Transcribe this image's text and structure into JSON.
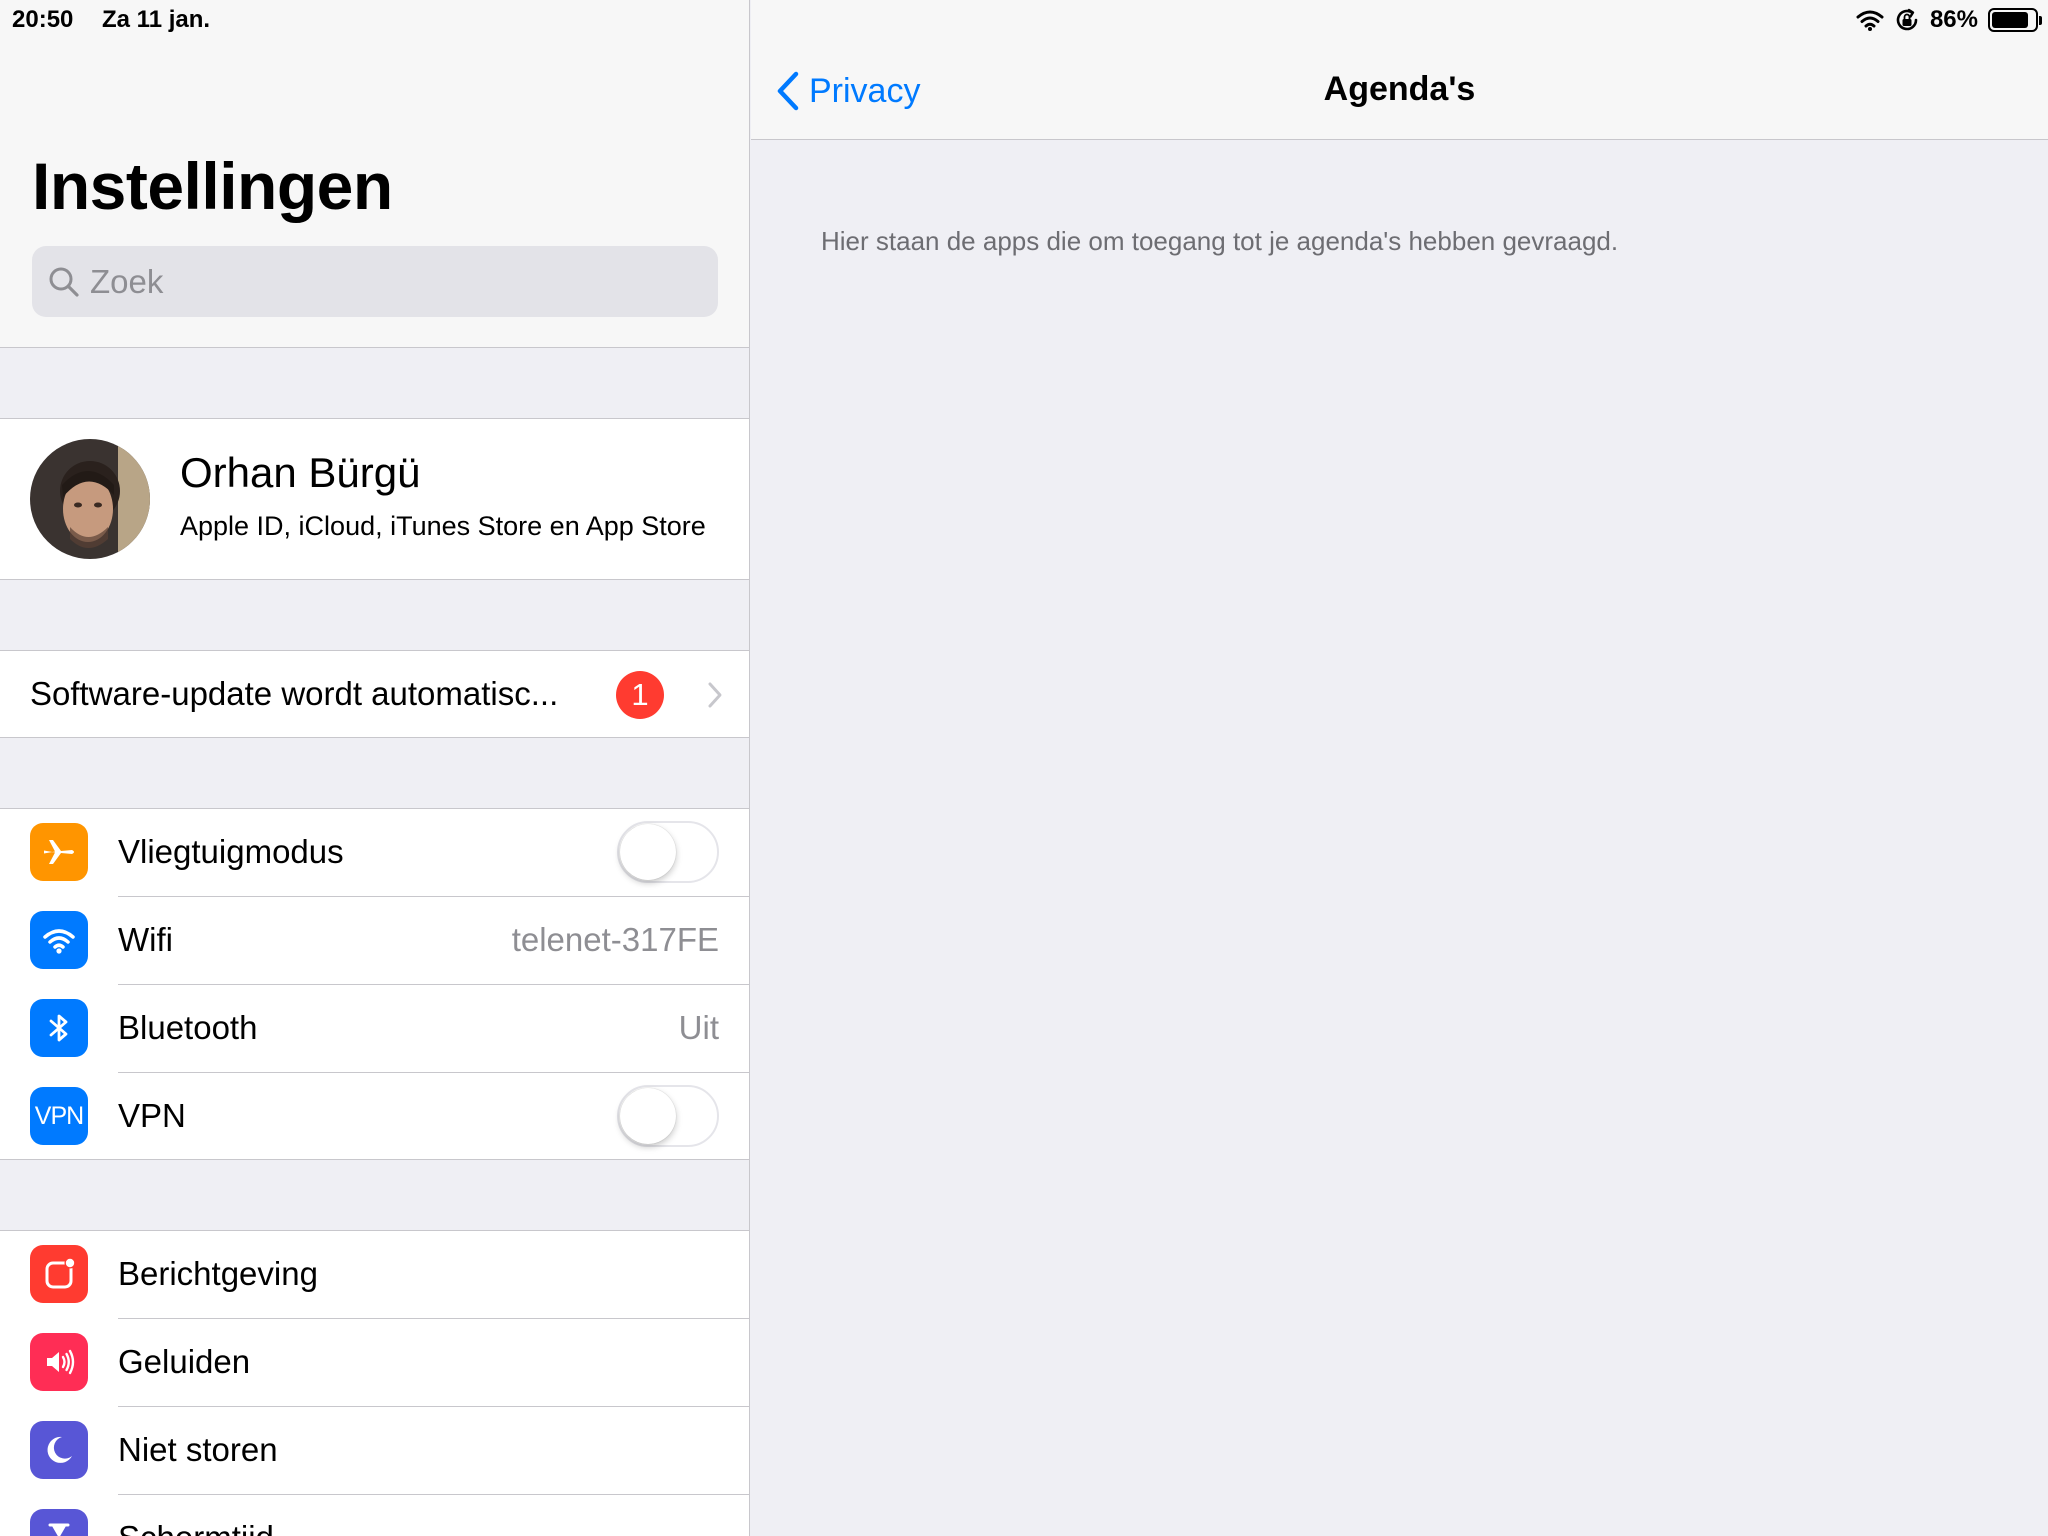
{
  "status_bar": {
    "time": "20:50",
    "date": "Za 11 jan.",
    "battery_percent": "86%",
    "battery_level": 0.86
  },
  "sidebar": {
    "title": "Instellingen",
    "search_placeholder": "Zoek",
    "profile": {
      "name": "Orhan Bürgü",
      "subtitle": "Apple ID, iCloud, iTunes Store en App Store"
    },
    "update": {
      "label": "Software-update wordt automatisc...",
      "badge": "1"
    },
    "network": [
      {
        "label": "Vliegtuigmodus",
        "icon": "airplane-icon",
        "color": "#ff9500",
        "toggle": false
      },
      {
        "label": "Wifi",
        "icon": "wifi-icon",
        "color": "#007aff",
        "value": "telenet-317FE"
      },
      {
        "label": "Bluetooth",
        "icon": "bluetooth-icon",
        "color": "#007aff",
        "value": "Uit"
      },
      {
        "label": "VPN",
        "icon": "vpn-icon",
        "icon_text": "VPN",
        "color": "#007aff",
        "toggle": false
      }
    ],
    "general": [
      {
        "label": "Berichtgeving",
        "icon": "notifications-icon",
        "color": "#ff3b30"
      },
      {
        "label": "Geluiden",
        "icon": "sounds-icon",
        "color": "#ff2d55"
      },
      {
        "label": "Niet storen",
        "icon": "moon-icon",
        "color": "#5856d6"
      },
      {
        "label": "Schermtijd",
        "icon": "hourglass-icon",
        "color": "#5856d6"
      }
    ]
  },
  "detail": {
    "back_label": "Privacy",
    "title": "Agenda's",
    "description": "Hier staan de apps die om toegang tot je agenda's hebben gevraagd."
  },
  "colors": {
    "accent": "#007aff",
    "badge": "#ff3b30",
    "background": "#efeff4"
  }
}
